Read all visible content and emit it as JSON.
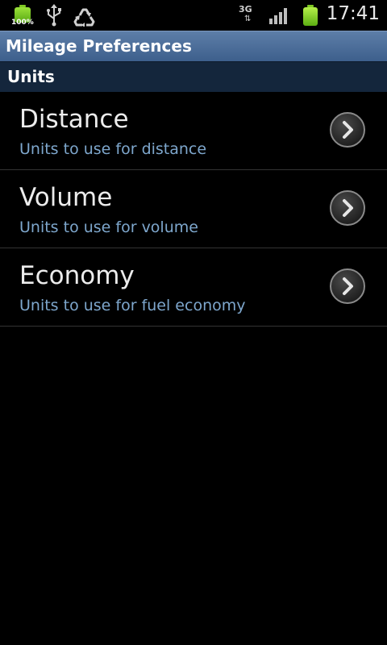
{
  "status_bar": {
    "battery_percent": "100%",
    "network": "3G",
    "network_arrows": "⇅",
    "time": "17:41",
    "icons": [
      "battery-icon",
      "usb-icon",
      "recycle-icon",
      "3g-icon",
      "signal-icon",
      "battery-icon"
    ],
    "battery_color": "#7ec823"
  },
  "app": {
    "title": "Mileage Preferences",
    "title_bar_color": "#4a6d99"
  },
  "category": {
    "label": "Units"
  },
  "preferences": [
    {
      "title": "Distance",
      "summary": "Units to use for distance",
      "icon": "chevron-right-icon"
    },
    {
      "title": "Volume",
      "summary": "Units to use for volume",
      "icon": "chevron-right-icon"
    },
    {
      "title": "Economy",
      "summary": "Units to use for fuel economy",
      "icon": "chevron-right-icon"
    }
  ],
  "colors": {
    "summary_text": "#7ea7cd",
    "background": "#000000"
  }
}
